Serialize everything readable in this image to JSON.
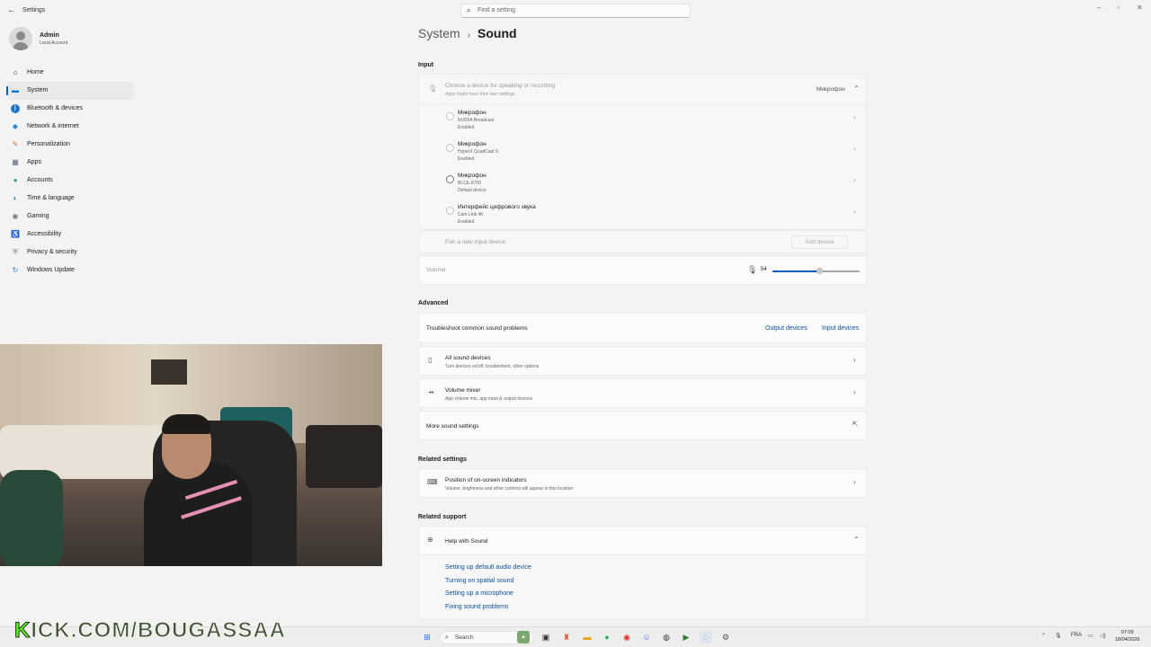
{
  "window": {
    "title": "Settings",
    "back_icon": "back-arrow-icon"
  },
  "search": {
    "placeholder": "Find a setting"
  },
  "user": {
    "name": "Admin",
    "account_type": "Local Account"
  },
  "nav": [
    {
      "label": "Home",
      "icon": "home-icon",
      "glyph": "⌂",
      "color": "#3a3a3a",
      "active": false
    },
    {
      "label": "System",
      "icon": "system-icon",
      "glyph": "▬",
      "color": "#0078d4",
      "active": true
    },
    {
      "label": "Bluetooth & devices",
      "icon": "bluetooth-icon",
      "glyph": "ᛒ",
      "color": "#ffffff",
      "active": false
    },
    {
      "label": "Network & internet",
      "icon": "wifi-icon",
      "glyph": "◆",
      "color": "#2b8cdc",
      "active": false
    },
    {
      "label": "Personalization",
      "icon": "brush-icon",
      "glyph": "✎",
      "color": "#d16b2f",
      "active": false
    },
    {
      "label": "Apps",
      "icon": "apps-icon",
      "glyph": "▦",
      "color": "#5a6b8a",
      "active": false
    },
    {
      "label": "Accounts",
      "icon": "accounts-icon",
      "glyph": "●",
      "color": "#2fa36b",
      "active": false
    },
    {
      "label": "Time & language",
      "icon": "globe-clock-icon",
      "glyph": "◐",
      "color": "#1e88c9",
      "active": false
    },
    {
      "label": "Gaming",
      "icon": "gamepad-icon",
      "glyph": "◉",
      "color": "#7a7a7a",
      "active": false
    },
    {
      "label": "Accessibility",
      "icon": "accessibility-icon",
      "glyph": "♿",
      "color": "#1e6fb8",
      "active": false
    },
    {
      "label": "Privacy & security",
      "icon": "shield-icon",
      "glyph": "⛨",
      "color": "#7b8591",
      "active": false
    },
    {
      "label": "Windows Update",
      "icon": "update-icon",
      "glyph": "↻",
      "color": "#1f75c9",
      "active": false
    }
  ],
  "breadcrumb": {
    "parent": "System",
    "separator": "›",
    "current": "Sound"
  },
  "input": {
    "section": "Input",
    "chooser": {
      "title": "Choose a device for speaking or recording",
      "subtitle": "Apps might have their own settings",
      "value": "Микрофон",
      "icon": "microphone-icon"
    },
    "devices": [
      {
        "name": "Микрофон",
        "model": "NVIDIA Broadcast",
        "status": "Enabled",
        "selected": false
      },
      {
        "name": "Микрофон",
        "model": "HyperX QuadCast S",
        "status": "Enabled",
        "selected": false
      },
      {
        "name": "Микрофон",
        "model": "BLCE-8700",
        "status": "Default device",
        "selected": true
      },
      {
        "name": "Интерфейс цифрового звука",
        "model": "Cam Link 4K",
        "status": "Enabled",
        "selected": false
      }
    ],
    "pair": {
      "label": "Pair a new input device",
      "button": "Add device"
    },
    "volume": {
      "label": "Volume",
      "value": "54",
      "level_percent": 54
    }
  },
  "advanced": {
    "section": "Advanced",
    "troubleshoot": {
      "label": "Troubleshoot common sound problems",
      "output_link": "Output devices",
      "input_link": "Input devices"
    },
    "all_devices": {
      "title": "All sound devices",
      "subtitle": "Turn devices on/off, troubleshoot, other options"
    },
    "mixer": {
      "title": "Volume mixer",
      "subtitle": "App volume mix, app input & output devices"
    },
    "more": {
      "label": "More sound settings"
    }
  },
  "related_settings": {
    "section": "Related settings",
    "indicators": {
      "title": "Position of on-screen indicators",
      "subtitle": "Volume, brightness and other controls will appear in this location"
    }
  },
  "related_support": {
    "section": "Related support",
    "help": {
      "title": "Help with Sound"
    },
    "links": [
      "Setting up default audio device",
      "Turning on spatial sound",
      "Setting up a microphone",
      "Fixing sound problems"
    ]
  },
  "taskbar": {
    "search_label": "Search",
    "lang": "FRA",
    "time": "07:09",
    "date": "18/04/2026"
  },
  "overlay": {
    "watermark_prefix": "K",
    "watermark": "KICK.COM/BOUGASSAA"
  }
}
